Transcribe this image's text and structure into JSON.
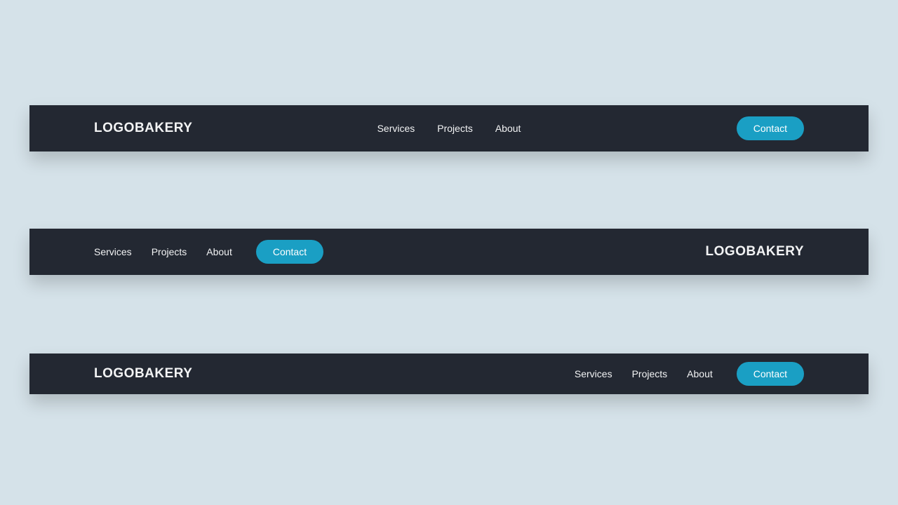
{
  "brand": "LOGOBAKERY",
  "nav": {
    "items": [
      {
        "label": "Services"
      },
      {
        "label": "Projects"
      },
      {
        "label": "About"
      }
    ],
    "cta_label": "Contact"
  },
  "colors": {
    "background": "#d5e2e9",
    "navbar": "#232832",
    "text": "#f2f3f4",
    "accent": "#1a9fc4"
  }
}
